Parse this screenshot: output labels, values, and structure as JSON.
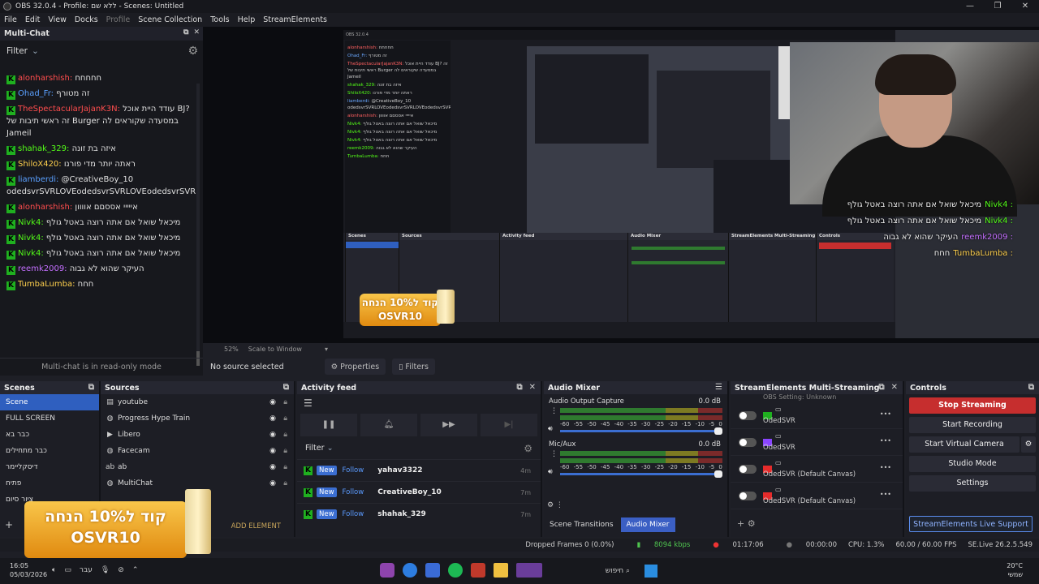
{
  "window": {
    "title": "OBS 32.0.4 - Profile: ללא שם - Scenes: Untitled",
    "controls": [
      "—",
      "❐",
      "✕"
    ]
  },
  "menu": [
    "File",
    "Edit",
    "View",
    "Docks",
    "Profile",
    "Scene Collection",
    "Tools",
    "Help",
    "StreamElements"
  ],
  "chat": {
    "title": "Multi-Chat",
    "filter": "Filter",
    "readonly": "Multi-chat is in read-only mode",
    "messages": [
      {
        "user": "alonharshish:",
        "color": "red",
        "text": "חחחחח"
      },
      {
        "user": "Ohad_Fr:",
        "color": "blue",
        "text": "זה מטורף"
      },
      {
        "user": "TheSpectacularJajanK3N:",
        "color": "red",
        "text": "עודד היית אוכל BJ? זה ראשי תיבות של Burger במסעדה שקוראים לה Jameil"
      },
      {
        "user": "shahak_329:",
        "color": "green",
        "text": "איזה בת זונה"
      },
      {
        "user": "ShiloX420:",
        "color": "yellow",
        "text": "ראתה יותר מדי פורנו"
      },
      {
        "user": "liamberdi:",
        "color": "blue",
        "text": "@CreativeBoy_10 odedsvrSVRLOVEodedsvrSVRLOVEodedsvrSVRLOVEodedsvrSVRLOVEodedsvrSVRLOVEodedsvrSVRLOVEodedsvrSVRLOVE"
      },
      {
        "user": "alonharshish:",
        "color": "red",
        "text": "אייייי אססםם אוווון"
      },
      {
        "user": "Nivk4:",
        "color": "green",
        "text": "מיכאל שואל אם אתה רוצה באטל גולף"
      },
      {
        "user": "Nivk4:",
        "color": "green",
        "text": "מיכאל שואל אם אתה רוצה באטל גולף"
      },
      {
        "user": "Nivk4:",
        "color": "green",
        "text": "מיכאל שואל אם אתה רוצה באטל גולף"
      },
      {
        "user": "reemk2009:",
        "color": "purple",
        "text": "העיקר שהוא לא גבוה"
      },
      {
        "user": "TumbaLumba:",
        "color": "yellow",
        "text": "חחח"
      }
    ]
  },
  "overlay_chat": [
    {
      "user": "Nivk4 :",
      "text": "מיכאל שואל אם אתה רוצה באטל גולף"
    },
    {
      "user": "Nivk4 :",
      "text": "מיכאל שואל אם אתה רוצה באטל גולף"
    },
    {
      "user": "reemk2009 :",
      "text": "העיקר שהוא לא גבוה"
    },
    {
      "user": "TumbaLumba :",
      "text": "חחח"
    }
  ],
  "promo": {
    "line1": "קוד ל10% הנחה",
    "line2": "OSVR10"
  },
  "preview_bar": {
    "zoom": "52%",
    "scale": "Scale to Window"
  },
  "source_bar": {
    "status": "No source selected",
    "properties": "Properties",
    "filters": "Filters"
  },
  "scenes": {
    "title": "Scenes",
    "items": [
      "Scene",
      "FULL SCREEN",
      "כבר בא",
      "כבר מתחילים",
      "דיסקליימר",
      "פתיח",
      "ציור סיום"
    ]
  },
  "sources": {
    "title": "Sources",
    "items": [
      {
        "name": "youtube",
        "icon": "▤"
      },
      {
        "name": "Progress Hype Train",
        "icon": "◍"
      },
      {
        "name": "Libero",
        "icon": "▶"
      },
      {
        "name": "Facecam",
        "icon": "◍"
      },
      {
        "name": "ab",
        "icon": "ab"
      },
      {
        "name": "MultiChat",
        "icon": "◍"
      }
    ],
    "add_element": "ADD ELEMENT"
  },
  "activity": {
    "title": "Activity feed",
    "filter": "Filter",
    "rows": [
      {
        "tag1": "New",
        "tag2": "Follow",
        "name": "yahav3322",
        "time": "4m"
      },
      {
        "tag1": "New",
        "tag2": "Follow",
        "name": "CreativeBoy_10",
        "time": "7m"
      },
      {
        "tag1": "New",
        "tag2": "Follow",
        "name": "shahak_329",
        "time": "7m"
      }
    ]
  },
  "mixer": {
    "title": "Audio Mixer",
    "channels": [
      {
        "name": "Audio Output Capture",
        "db": "0.0 dB"
      },
      {
        "name": "Mic/Aux",
        "db": "0.0 dB"
      }
    ],
    "scale": [
      "-60",
      "-55",
      "-50",
      "-45",
      "-40",
      "-35",
      "-30",
      "-25",
      "-20",
      "-15",
      "-10",
      "-5",
      "0"
    ],
    "tabs": [
      "Scene Transitions",
      "Audio Mixer"
    ]
  },
  "multistream": {
    "title": "StreamElements Multi-Streaming",
    "top": "OBS Setting: Unknown",
    "rows": [
      {
        "label": "OdedSVR",
        "platform": "kick",
        "color": "#1fb01f"
      },
      {
        "label": "OdedSVR",
        "platform": "twitch",
        "color": "#8a45ff"
      },
      {
        "label": "OdedSVR (Default Canvas)",
        "platform": "youtube",
        "color": "#e62b2b"
      },
      {
        "label": "OdedSVR (Default Canvas)",
        "platform": "youtube",
        "color": "#e62b2b"
      }
    ]
  },
  "controls": {
    "title": "Controls",
    "buttons": [
      "Stop Streaming",
      "Start Recording",
      "Start Virtual Camera",
      "Studio Mode",
      "Settings"
    ],
    "support": "StreamElements Live Support"
  },
  "status": {
    "dropped": "Dropped Frames 0 (0.0%)",
    "kbps": "8094 kbps",
    "live": "01:17:06",
    "rec": "00:00:00",
    "cpu": "CPU: 1.3%",
    "fps": "60.00 / 60.00 FPS",
    "version": "SE.Live 26.2.5.549"
  },
  "taskbar": {
    "time": "16:05",
    "date": "05/03/2026",
    "lang": "עבר",
    "search": "חיפוש",
    "weather": "20°C",
    "weather_desc": "שמשי"
  }
}
